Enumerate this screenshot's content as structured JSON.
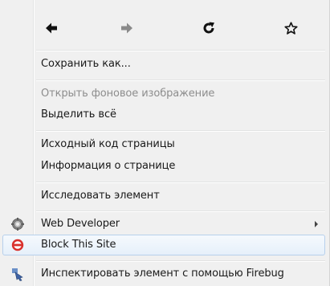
{
  "nav": {
    "back_icon": "back-arrow-icon",
    "forward_icon": "forward-arrow-icon",
    "reload_icon": "reload-icon",
    "bookmark_icon": "star-icon"
  },
  "menu": {
    "items": [
      {
        "label": "Сохранить как...",
        "disabled": false
      },
      {
        "label": "Открыть фоновое изображение",
        "disabled": true
      },
      {
        "label": "Выделить всё",
        "disabled": false
      },
      {
        "label": "Исходный код страницы",
        "disabled": false
      },
      {
        "label": "Информация о странице",
        "disabled": false
      },
      {
        "label": "Исследовать элемент",
        "disabled": false
      },
      {
        "label": "Web Developer",
        "disabled": false,
        "icon": "gear-icon",
        "submenu": true
      },
      {
        "label": "Block This Site",
        "disabled": false,
        "icon": "block-icon",
        "highlighted": true
      },
      {
        "label": "Инспектировать элемент с помощью Firebug",
        "disabled": false,
        "icon": "firebug-icon"
      }
    ]
  },
  "colors": {
    "menu_background": "#f0f0f0",
    "hover_border": "#b7d0ec",
    "disabled_text": "#8d8d8d",
    "block_icon_red": "#d9302c"
  }
}
